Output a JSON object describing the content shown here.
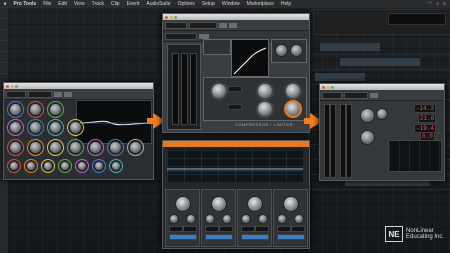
{
  "menubar": {
    "app_name": "Pro Tools",
    "items": [
      "File",
      "Edit",
      "View",
      "Track",
      "Clip",
      "Event",
      "AudioSuite",
      "Options",
      "Setup",
      "Window",
      "Marketplace",
      "Help"
    ]
  },
  "compressor": {
    "brand": "COMPRESSOR / LIMITER"
  },
  "limiter": {
    "readouts": [
      "-14.3",
      "21.6",
      "-19.4",
      "0.0"
    ]
  },
  "watermark": {
    "mark": "NE",
    "line1": "NonLinear",
    "line2": "Educating Inc."
  },
  "colors": {
    "arrow": "#f07d1e",
    "readout": "#ff4a3c",
    "accent_orange": "#e77a20"
  }
}
